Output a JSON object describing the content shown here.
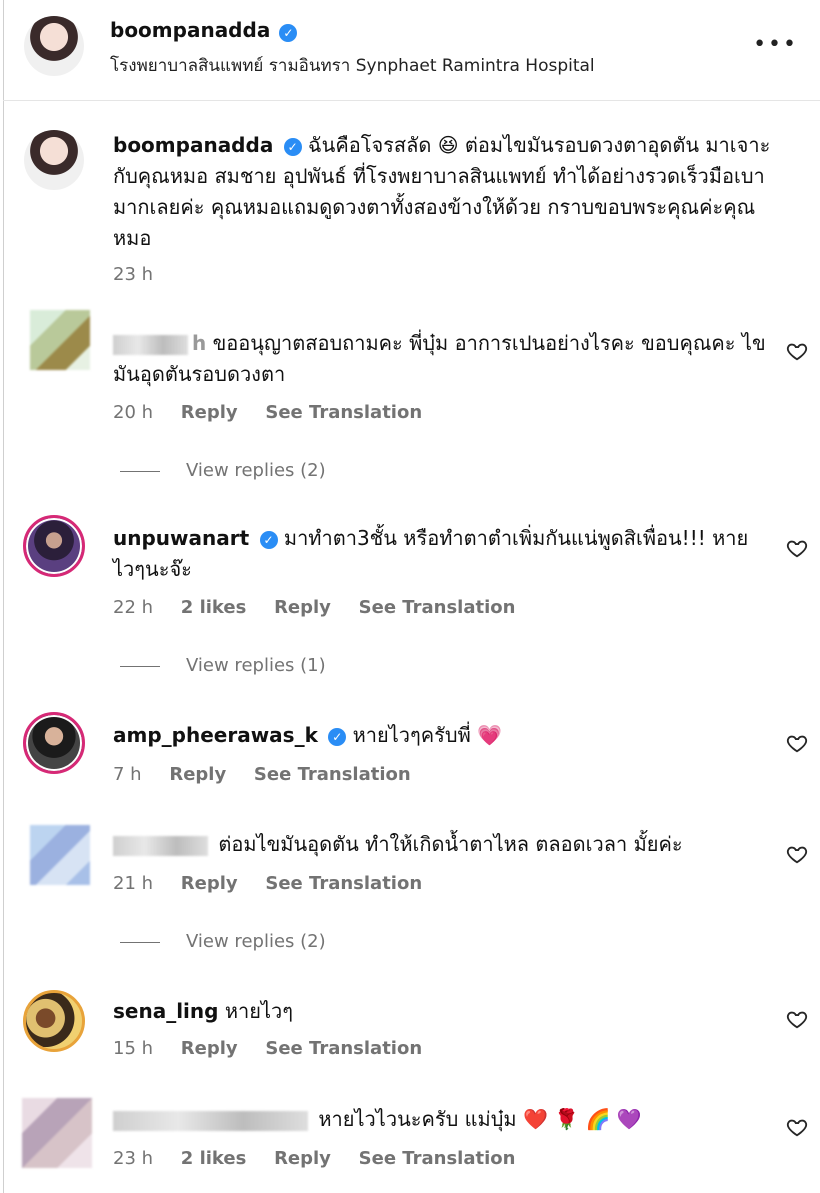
{
  "header": {
    "username": "boompanadda",
    "location": "โรงพยาบาลสินแพทย์ รามอินทรา Synphaet Ramintra Hospital",
    "more_label": "•••"
  },
  "caption": {
    "username": "boompanadda",
    "text": "ฉันคือโจรสลัด 😆 ต่อมไขมันรอบดวงตาอุดตัน มาเจาะกับคุณหมอ สมชาย อุปพันธ์ ที่โรงพยาบาลสินแพทย์ ทำได้อย่างรวดเร็วมือเบามากเลยค่ะ คุณหมอแถมดูดวงตาทั้งสองข้างให้ด้วย กราบขอบพระคุณค่ะคุณหมอ",
    "time": "23 h"
  },
  "comments": [
    {
      "username_tail": "h",
      "text": "ขออนุญาตสอบถามคะ พี่บุ๋ม อาการเปนอย่างไรคะ ขอบคุณคะ ไขมันอุดตันรอบดวงตา",
      "time": "20 h",
      "likes": "",
      "reply": "Reply",
      "translate": "See Translation",
      "view_replies": "View replies (2)"
    },
    {
      "username": "unpuwanart",
      "text": "มาทำตา3ชั้น หรือทำตาตำเพิ่มกันแน่พูดสิเพื่อน!!! หายไวๆนะจ๊ะ",
      "time": "22 h",
      "likes": "2 likes",
      "reply": "Reply",
      "translate": "See Translation",
      "view_replies": "View replies (1)"
    },
    {
      "username": "amp_pheerawas_k",
      "text": "หายไวๆครับพี่ 💗",
      "time": "7 h",
      "likes": "",
      "reply": "Reply",
      "translate": "See Translation",
      "view_replies": ""
    },
    {
      "username_tail": "",
      "text": "ต่อมไขมันอุดตัน ทำให้เกิดน้ำตาไหล ตลอดเวลา มั้ยค่ะ",
      "time": "21 h",
      "likes": "",
      "reply": "Reply",
      "translate": "See Translation",
      "view_replies": "View replies (2)"
    },
    {
      "username": "sena_ling",
      "text": "หายไวๆ",
      "time": "15 h",
      "likes": "",
      "reply": "Reply",
      "translate": "See Translation",
      "view_replies": ""
    },
    {
      "username_tail": "",
      "text": "หายไวไวนะครับ แม่บุ๋ม ❤️ 🌹 🌈 💜",
      "time": "23 h",
      "likes": "2 likes",
      "reply": "Reply",
      "translate": "See Translation",
      "view_replies": ""
    }
  ],
  "icons": {
    "heart": "heart-outline-icon",
    "verified": "verified-badge-icon",
    "more": "more-icon"
  },
  "colors": {
    "verified": "#2a8df5",
    "meta": "#737373",
    "ring": "#d62976"
  }
}
